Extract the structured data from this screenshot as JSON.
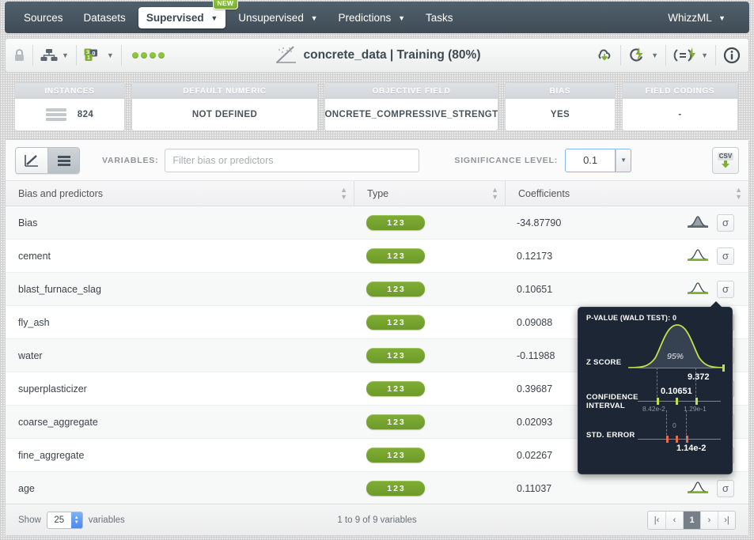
{
  "nav": {
    "items": [
      {
        "label": "Sources",
        "caret": false,
        "active": false
      },
      {
        "label": "Datasets",
        "caret": false,
        "active": false
      },
      {
        "label": "Supervised",
        "caret": true,
        "active": true,
        "badge": "NEW"
      },
      {
        "label": "Unsupervised",
        "caret": true,
        "active": false
      },
      {
        "label": "Predictions",
        "caret": true,
        "active": false
      },
      {
        "label": "Tasks",
        "caret": false,
        "active": false
      }
    ],
    "right": {
      "label": "WhizzML",
      "caret": true
    }
  },
  "titlebar": {
    "title": "concrete_data | Training (80%)",
    "lock_icon": "lock-icon",
    "share_icon": "share-network-icon",
    "count_icon": "field-counts-icon",
    "status_dots": 4,
    "download_icon": "cloud-download-icon",
    "actions_icon": "lightning-actions-icon",
    "script_icon": "script-actions-icon",
    "info_icon": "info-icon"
  },
  "cards": [
    {
      "header": "INSTANCES",
      "value": "824",
      "has_bars": true
    },
    {
      "header": "DEFAULT NUMERIC",
      "value": "NOT DEFINED",
      "has_bars": false
    },
    {
      "header": "OBJECTIVE FIELD",
      "value": "CONCRETE_COMPRESSIVE_STRENGTH",
      "has_bars": false
    },
    {
      "header": "BIAS",
      "value": "YES",
      "has_bars": false
    },
    {
      "header": "FIELD CODINGS",
      "value": "-",
      "has_bars": false
    }
  ],
  "toolbar": {
    "chart_view_icon": "line-chart-icon",
    "list_view_icon": "list-view-icon",
    "variables_label": "VARIABLES:",
    "filter_placeholder": "Filter bias or predictors",
    "filter_value": "",
    "significance_label": "SIGNIFICANCE LEVEL:",
    "significance_value": "0.1",
    "significance_options": [
      "0.1"
    ],
    "export_icon": "csv-download-icon",
    "export_label": "CSV"
  },
  "table": {
    "columns": [
      "Bias and predictors",
      "Type",
      "Coefficients"
    ],
    "rows": [
      {
        "name": "Bias",
        "type": "123",
        "coefficient": "-34.87790",
        "dist_icon": "normal-distribution-filled-icon",
        "sigma_label": "σ"
      },
      {
        "name": "cement",
        "type": "123",
        "coefficient": "0.12173",
        "dist_icon": "normal-distribution-icon",
        "sigma_label": "σ"
      },
      {
        "name": "blast_furnace_slag",
        "type": "123",
        "coefficient": "0.10651",
        "dist_icon": "normal-distribution-icon",
        "sigma_label": "σ"
      },
      {
        "name": "fly_ash",
        "type": "123",
        "coefficient": "0.09088",
        "dist_icon": "normal-distribution-icon",
        "sigma_label": "σ"
      },
      {
        "name": "water",
        "type": "123",
        "coefficient": "-0.11988",
        "dist_icon": "normal-distribution-icon",
        "sigma_label": "σ"
      },
      {
        "name": "superplasticizer",
        "type": "123",
        "coefficient": "0.39687",
        "dist_icon": "normal-distribution-icon",
        "sigma_label": "σ"
      },
      {
        "name": "coarse_aggregate",
        "type": "123",
        "coefficient": "0.02093",
        "dist_icon": "normal-distribution-icon",
        "sigma_label": "σ"
      },
      {
        "name": "fine_aggregate",
        "type": "123",
        "coefficient": "0.02267",
        "dist_icon": "normal-distribution-icon",
        "sigma_label": "σ"
      },
      {
        "name": "age",
        "type": "123",
        "coefficient": "0.11037",
        "dist_icon": "normal-distribution-icon",
        "sigma_label": "σ"
      }
    ]
  },
  "footer": {
    "show_label": "Show",
    "page_size": "25",
    "variables_label": "variables",
    "range_text": "1 to 9 of 9 variables",
    "pager": {
      "first": "|‹",
      "prev": "‹",
      "current": "1",
      "next": "›",
      "last": "›|"
    }
  },
  "tooltip": {
    "pvalue_label": "P-VALUE (WALD TEST): 0",
    "curve_label": "95%",
    "zscore_label": "Z SCORE",
    "zscore_value": "9.372",
    "ci_label_line1": "CONFIDENCE",
    "ci_label_line2": "INTERVAL",
    "ci_value": "0.10651",
    "ci_lower": "8.42e-2",
    "ci_upper": "1.29e-1",
    "se_label": "STD. ERROR",
    "se_value": "1.14e-2",
    "se_zero": "0"
  },
  "colors": {
    "nav_bg": "#475560",
    "accent_green": "#7fae33",
    "chip_green": "#6d9a2a",
    "tooltip_bg": "#1d2635",
    "curve_green": "#c3e04a",
    "se_red": "#f0674a",
    "focus_blue": "#8ab4f8"
  }
}
